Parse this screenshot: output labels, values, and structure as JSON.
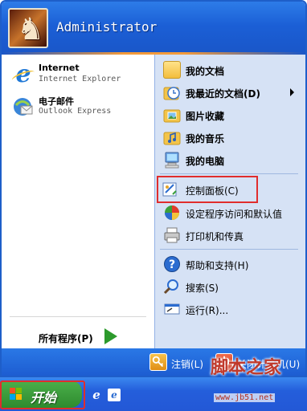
{
  "header": {
    "user_name": "Administrator"
  },
  "pinned": [
    {
      "title": "Internet",
      "subtitle": "Internet Explorer"
    },
    {
      "title": "电子邮件",
      "subtitle": "Outlook Express"
    }
  ],
  "all_programs": {
    "label": "所有程序(P)"
  },
  "right_items": {
    "my_documents": "我的文档",
    "recent_documents": "我最近的文档(D)",
    "my_pictures": "图片收藏",
    "my_music": "我的音乐",
    "my_computer": "我的电脑",
    "control_panel": "控制面板(C)",
    "program_access": "设定程序访问和默认值",
    "printers": "打印机和传真",
    "help": "帮助和支持(H)",
    "search": "搜索(S)",
    "run": "运行(R)..."
  },
  "footer": {
    "logoff": "注销(L)",
    "shutdown": "关闭计算机(U)"
  },
  "taskbar": {
    "start_label": "开始"
  },
  "watermark": {
    "site_name": "脚本之家",
    "site_url": "www.jb51.net"
  },
  "colors": {
    "highlight_box": "#e02d2d",
    "header_blue": "#1b5fd6",
    "start_green": "#2e8a2e",
    "right_pane": "#d6e2f5"
  }
}
